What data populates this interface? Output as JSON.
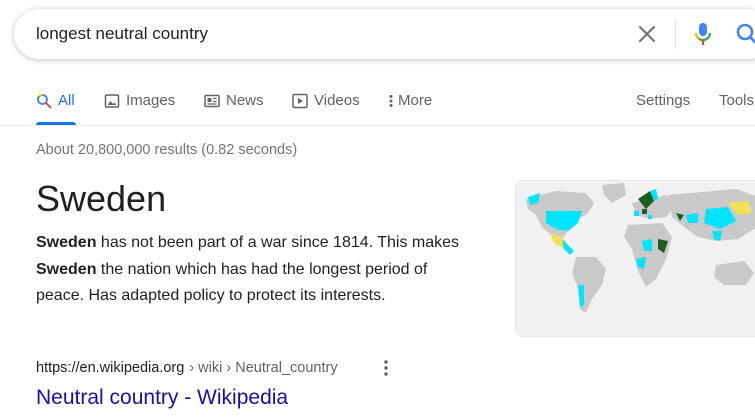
{
  "search": {
    "query": "longest neutral country"
  },
  "tabs": [
    {
      "label": "All",
      "icon": "search-icon"
    },
    {
      "label": "Images",
      "icon": "image-icon"
    },
    {
      "label": "News",
      "icon": "news-icon"
    },
    {
      "label": "Videos",
      "icon": "play-icon"
    },
    {
      "label": "More",
      "icon": "more-vert-icon"
    }
  ],
  "tools": {
    "settings": "Settings",
    "tools": "Tools"
  },
  "result_stats": "About 20,800,000 results (0.82 seconds)",
  "featured": {
    "title": "Sweden",
    "snippet": [
      {
        "text": "Sweden",
        "bold": true
      },
      {
        "text": " has not been part of a war since 1814. This makes ",
        "bold": false
      },
      {
        "text": "Sweden",
        "bold": true
      },
      {
        "text": " the nation which has had the longest period of peace. Has adapted policy to protect its interests.",
        "bold": false
      }
    ]
  },
  "source": {
    "domain": "https://en.wikipedia.org",
    "path": "› wiki › Neutral_country",
    "link_title": "Neutral country - Wikipedia"
  },
  "colors": {
    "accent": "#1a73e8",
    "link": "#1a0dab",
    "map_neutral": "#00e5ff",
    "map_dark": "#1b5e20",
    "map_yellow": "#f2e25a",
    "map_land": "#c9c9c9"
  }
}
